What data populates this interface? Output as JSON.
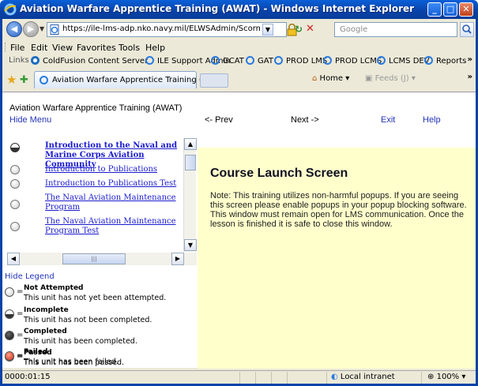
{
  "window": {
    "title": "Aviation Warfare Apprentice Training (AWAT) - Windows Internet Explorer",
    "minimize": "_",
    "maximize": "□",
    "close": "✕"
  },
  "address_bar": {
    "url": "https://ile-lms-adp.nko.navy.mil/ELWSAdmin/ScormEngine/Remote.",
    "search_placeholder": "Google"
  },
  "menu": [
    "File",
    "Edit",
    "View",
    "Favorites",
    "Tools",
    "Help"
  ],
  "links_bar": {
    "label": "Links",
    "items": [
      "ColdFusion Content Server",
      "ILE Support Admin",
      "GCAT",
      "GAT",
      "PROD LMS",
      "PROD LCMS",
      "LCMS DEV",
      "Reports"
    ]
  },
  "tab": {
    "title": "Aviation Warfare Apprentice Training (AWAT)"
  },
  "command_bar": {
    "home": "Home",
    "feeds": "Feeds (J)"
  },
  "course": {
    "title": "Aviation Warfare Apprentice Training (AWAT)",
    "hide_menu": "Hide Menu",
    "prev": "<- Prev",
    "next": "Next ->",
    "exit": "Exit",
    "help": "Help"
  },
  "toc": [
    {
      "label": "Introduction to the Naval and Marine Corps Aviation Community",
      "status": "incomplete",
      "current": true
    },
    {
      "label": "Introduction to Publications",
      "status": "not-attempted",
      "current": false
    },
    {
      "label": "Introduction to Publications Test",
      "status": "not-attempted",
      "current": false
    },
    {
      "label": "The Naval Aviation Maintenance Program",
      "status": "not-attempted",
      "current": false
    },
    {
      "label": "The Naval Aviation Maintenance Program Test",
      "status": "not-attempted",
      "current": false
    }
  ],
  "legend": {
    "title": "Hide Legend",
    "items": [
      {
        "name": "Not Attempted",
        "desc": "This unit has not yet been attempted.",
        "color": "#dcdcdc"
      },
      {
        "name": "Incomplete",
        "desc": "This unit has not been completed.",
        "color": "#555555"
      },
      {
        "name": "Completed",
        "desc": "This unit has been completed.",
        "color": "#111111"
      },
      {
        "name": "Passed",
        "desc": "This unit has been passed.",
        "color": "#33aa33"
      },
      {
        "name": "Failed",
        "desc": "This unit has been failed.",
        "color": "#dd3322"
      }
    ]
  },
  "content": {
    "title": "Course Launch Screen",
    "note": "Note: This training utilizes non-harmful popups. If you are seeing this screen please enable popups in your popup blocking software. This window must remain open for LMS communication. Once the lesson is finished it is safe to close this window."
  },
  "status_bar": {
    "time": "0000:01:15",
    "zone": "Local intranet",
    "zoom": "100%"
  },
  "colors": {
    "content_background": "#ffffcc",
    "link_blue": "#1a1ad0",
    "titlebar_blue": "#0842a8"
  }
}
